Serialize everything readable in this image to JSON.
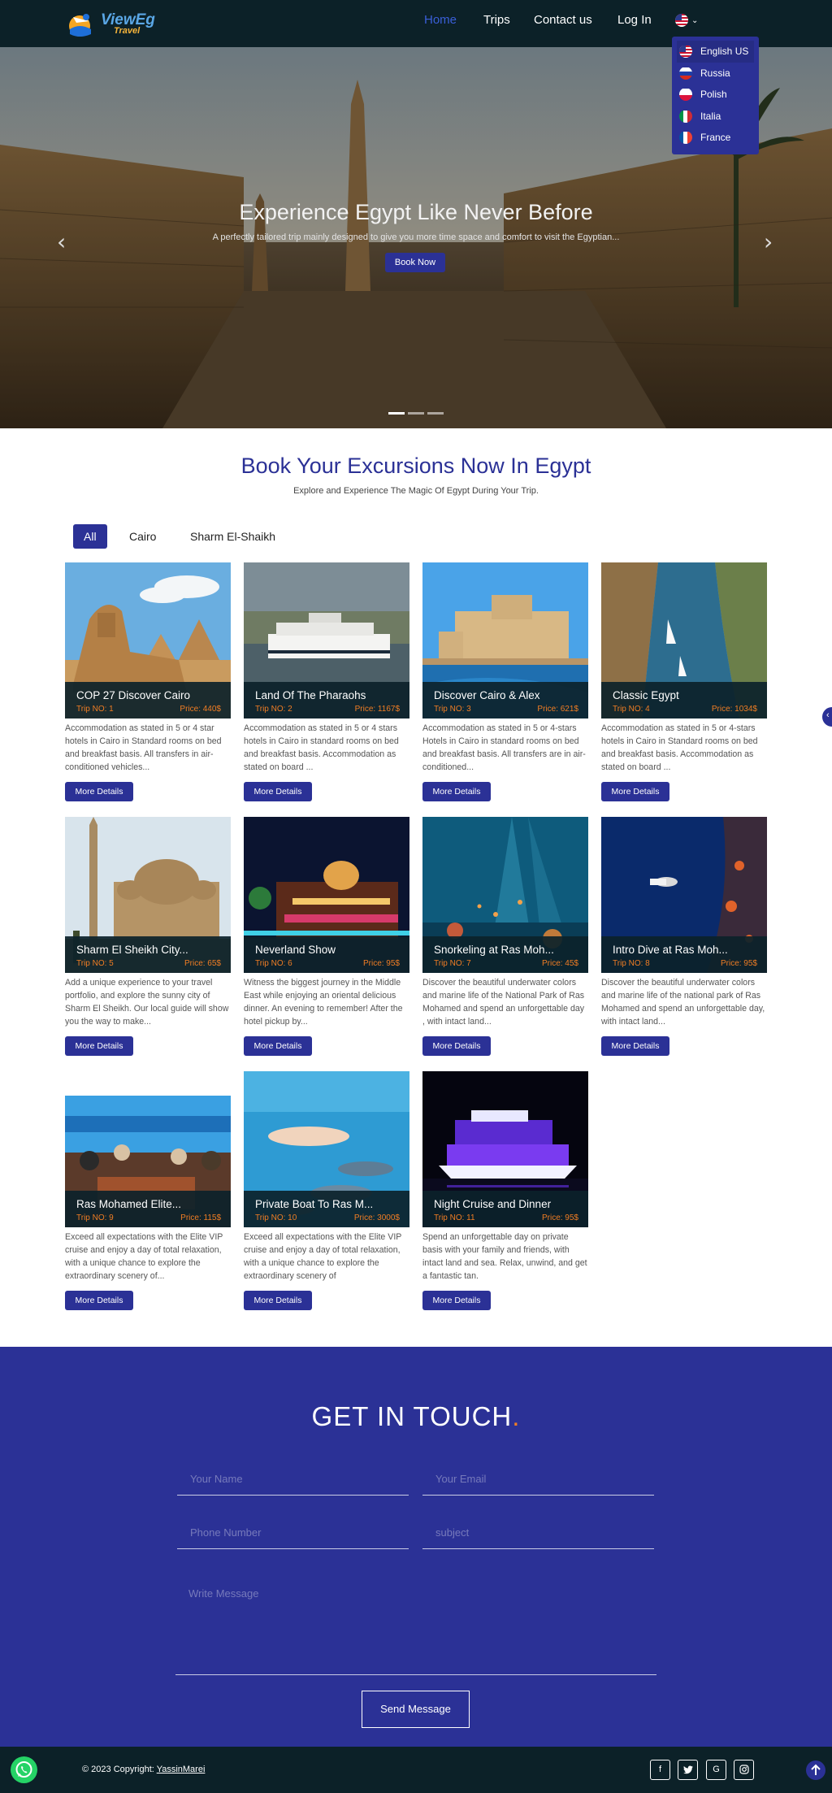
{
  "header": {
    "logo_text": "ViewEg",
    "logo_sub": "Travel",
    "nav": [
      "Home",
      "Trips",
      "Contact us",
      "Log In"
    ],
    "active": "Home"
  },
  "languages": [
    "English US",
    "Russia",
    "Polish",
    "Italia",
    "France"
  ],
  "selected_language": "English US",
  "hero": {
    "title": "Experience Egypt Like Never Before",
    "subtitle": "A perfectly tailored trip mainly designed to give you more time space and comfort to visit the Egyptian...",
    "button": "Book Now",
    "slides": 3,
    "active_slide": 1
  },
  "section": {
    "title": "Book Your Excursions Now In Egypt",
    "subtitle": "Explore and Experience The Magic Of Egypt During Your Trip.",
    "filters": [
      "All",
      "Cairo",
      "Sharm El-Shaikh"
    ],
    "active_filter": "All"
  },
  "trips": [
    {
      "title": "COP 27 Discover Cairo",
      "trip": "Trip NO: 1",
      "price": "Price: 440$",
      "desc": "Accommodation as stated in 5 or 4 star hotels in Cairo in Standard rooms on bed and breakfast basis. All transfers in air-conditioned vehicles...",
      "button": "More Details",
      "scene": "sphinx"
    },
    {
      "title": "Land Of The Pharaohs",
      "trip": "Trip NO: 2",
      "price": "Price: 1167$",
      "desc": "Accommodation as stated in 5 or 4 stars hotels in Cairo in standard rooms on bed and breakfast basis. Accommodation as stated on board ...",
      "button": "More Details",
      "scene": "nile-cruise"
    },
    {
      "title": "Discover Cairo & Alex",
      "trip": "Trip NO: 3",
      "price": "Price: 621$",
      "desc": "Accommodation as stated in 5 or 4-stars Hotels in Cairo in standard rooms on bed and breakfast basis. All transfers are in air-conditioned...",
      "button": "More Details",
      "scene": "citadel"
    },
    {
      "title": "Classic Egypt",
      "trip": "Trip NO: 4",
      "price": "Price: 1034$",
      "desc": "Accommodation as stated in 5 or 4-stars hotels in Cairo in Standard rooms on bed and breakfast basis. Accommodation as stated on board ...",
      "button": "More Details",
      "scene": "aswan"
    },
    {
      "title": "Sharm El Sheikh City...",
      "trip": "Trip NO: 5",
      "price": "Price: 65$",
      "desc": "Add a unique experience to your travel portfolio, and explore the sunny city of Sharm El Sheikh. Our local guide will show you the way to make...",
      "button": "More Details",
      "scene": "mosque"
    },
    {
      "title": "Neverland Show",
      "trip": "Trip NO: 6",
      "price": "Price: 95$",
      "desc": "Witness the biggest journey in the Middle East while enjoying an oriental delicious dinner. An evening to remember! After the hotel pickup by...",
      "button": "More Details",
      "scene": "night-show"
    },
    {
      "title": "Snorkeling at Ras Moh...",
      "trip": "Trip NO: 7",
      "price": "Price: 45$",
      "desc": "Discover the beautiful underwater colors and marine life of the National Park of Ras Mohamed and spend an unforgettable day , with intact land...",
      "button": "More Details",
      "scene": "reef"
    },
    {
      "title": "Intro Dive at Ras Moh...",
      "trip": "Trip NO: 8",
      "price": "Price: 95$",
      "desc": "Discover the beautiful underwater colors and marine life of the national park of Ras Mohamed and spend an unforgettable day, with intact land...",
      "button": "More Details",
      "scene": "dive"
    },
    {
      "title": "Ras Mohamed Elite...",
      "trip": "Trip NO: 9",
      "price": "Price: 115$",
      "desc": "Exceed all expectations with the Elite VIP cruise and enjoy a day of total relaxation, with a unique chance to explore the extraordinary scenery of...",
      "button": "More Details",
      "scene": "yacht-deck"
    },
    {
      "title": "Private Boat To Ras M...",
      "trip": "Trip NO: 10",
      "price": "Price: 3000$",
      "desc": "Exceed all expectations with the Elite VIP cruise and enjoy a day of total relaxation, with a unique chance to explore the extraordinary scenery of",
      "button": "More Details",
      "scene": "dolphins"
    },
    {
      "title": "Night Cruise and Dinner",
      "trip": "Trip NO: 11",
      "price": "Price: 95$",
      "desc": "Spend an unforgettable day on private basis with your family and friends, with intact land and sea. Relax, unwind, and get a fantastic tan.",
      "button": "More Details",
      "scene": "night-boat"
    }
  ],
  "contact": {
    "title": "GET IN TOUCH",
    "title_accent": ".",
    "placeholders": {
      "name": "Your Name",
      "email": "Your Email",
      "phone": "Phone Number",
      "subject": "subject",
      "message": "Write Message"
    },
    "button": "Send Message"
  },
  "footer": {
    "copyright": "© 2023 Copyright:",
    "author": "YassinMarei",
    "social": [
      "facebook-icon",
      "twitter-icon",
      "google-icon",
      "instagram-icon"
    ]
  },
  "colors": {
    "brand": "#2b3196",
    "accent": "#f07d24",
    "dark": "#0c2128"
  }
}
